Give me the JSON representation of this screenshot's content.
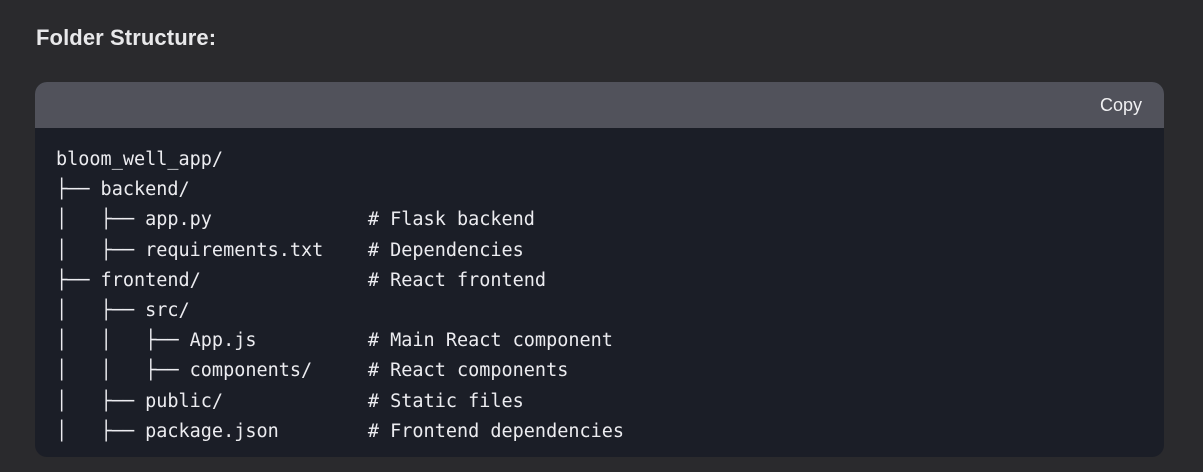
{
  "heading": "Folder Structure:",
  "code_block": {
    "copy_label": "Copy",
    "lines": [
      "bloom_well_app/",
      "├── backend/",
      "│   ├── app.py              # Flask backend",
      "│   ├── requirements.txt    # Dependencies",
      "├── frontend/               # React frontend",
      "│   ├── src/",
      "│   │   ├── App.js          # Main React component",
      "│   │   ├── components/     # React components",
      "│   ├── public/             # Static files",
      "│   ├── package.json        # Frontend dependencies"
    ]
  },
  "colors": {
    "page_background": "#2a2a2d",
    "code_header": "#51525b",
    "code_background": "#1b1e27",
    "text": "#ececf0"
  }
}
